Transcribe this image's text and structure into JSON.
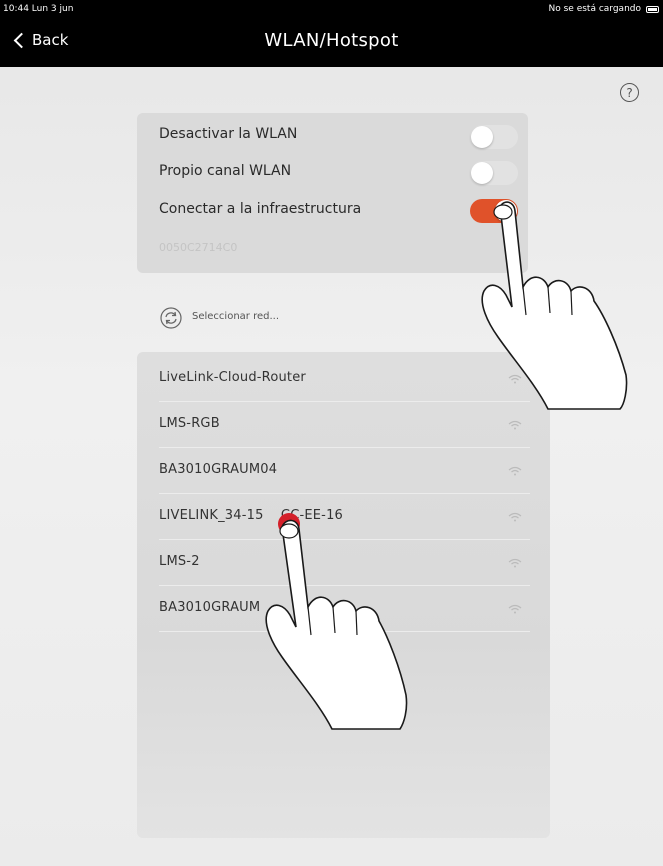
{
  "status_bar": {
    "time": "10:44  Lun 3 jun",
    "charge_text": "No se está cargando"
  },
  "nav": {
    "back_label": "Back",
    "title": "WLAN/Hotspot"
  },
  "help": {
    "icon_char": "?"
  },
  "settings": {
    "rows": [
      {
        "label": "Desactivar la WLAN",
        "toggle": false
      },
      {
        "label": "Propio canal WLAN",
        "toggle": false
      },
      {
        "label": "Conectar a la infraestructura",
        "toggle": true
      }
    ],
    "faded_text": "0050C2714C0"
  },
  "select_network": {
    "label": "Seleccionar red..."
  },
  "networks": [
    {
      "name": "LiveLink-Cloud-Router"
    },
    {
      "name": "LMS-RGB"
    },
    {
      "name": "BA3010GRAUM04"
    },
    {
      "name": "LIVELINK_34-15    CC-EE-16"
    },
    {
      "name": "LMS-2"
    },
    {
      "name": "BA3010GRAUM"
    }
  ],
  "colors": {
    "accent": "#e0522a",
    "touch": "#d4202a",
    "bar": "#000000"
  }
}
